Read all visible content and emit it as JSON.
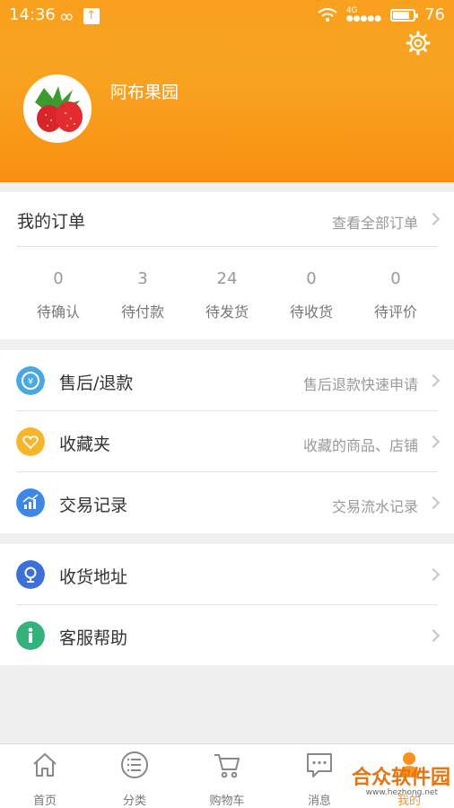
{
  "status": {
    "time": "14:36",
    "network": "4G",
    "battery": "76"
  },
  "profile": {
    "shop_name": "阿布果园"
  },
  "orders": {
    "title": "我的订单",
    "link": "查看全部订单",
    "stats": [
      {
        "count": "0",
        "label": "待确认"
      },
      {
        "count": "3",
        "label": "待付款"
      },
      {
        "count": "24",
        "label": "待发货"
      },
      {
        "count": "0",
        "label": "待收货"
      },
      {
        "count": "0",
        "label": "待评价"
      }
    ]
  },
  "menu": [
    {
      "title": "售后/退款",
      "sub": "售后退款快速申请",
      "icon": "refund-icon",
      "color": "#4aa8e0"
    },
    {
      "title": "收藏夹",
      "sub": "收藏的商品、店铺",
      "icon": "heart-icon",
      "color": "#f7b52c"
    },
    {
      "title": "交易记录",
      "sub": "交易流水记录",
      "icon": "chart-icon",
      "color": "#3d88e6"
    },
    {
      "title": "收货地址",
      "sub": "",
      "icon": "location-icon",
      "color": "#3d6fd9"
    },
    {
      "title": "客服帮助",
      "sub": "",
      "icon": "info-icon",
      "color": "#34b27b"
    }
  ],
  "tabs": [
    {
      "label": "首页",
      "icon": "home-icon"
    },
    {
      "label": "分类",
      "icon": "list-icon"
    },
    {
      "label": "购物车",
      "icon": "cart-icon"
    },
    {
      "label": "消息",
      "icon": "message-icon"
    },
    {
      "label": "我的",
      "icon": "user-icon"
    }
  ],
  "watermark": {
    "text": "合众软件园",
    "url": "www.hezhong.net"
  },
  "colors": {
    "header": "#f9a01e",
    "active_tab": "#f7931e"
  }
}
